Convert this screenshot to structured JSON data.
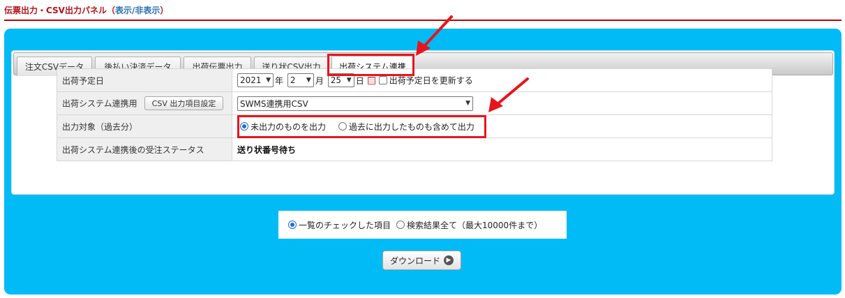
{
  "header": {
    "title": "伝票出力・CSV出力パネル（",
    "toggle_label": "表示/非表示",
    "title_close": "）"
  },
  "tabs": [
    {
      "label": "注文CSVデータ"
    },
    {
      "label": "後払い決済データ"
    },
    {
      "label": "出荷伝票出力"
    },
    {
      "label": "送り状CSV出力"
    },
    {
      "label": "出荷システム連携",
      "active": true
    }
  ],
  "form": {
    "ship_date": {
      "label": "出荷予定日",
      "year": "2021",
      "year_unit": "年",
      "month": "2",
      "month_unit": "月",
      "day": "25",
      "day_unit": "日",
      "update_label": "出荷予定日を更新する"
    },
    "integration": {
      "label": "出荷システム連携用",
      "csv_settings_button": "CSV 出力項目設定",
      "selected": "SWMS連携用CSV"
    },
    "target": {
      "label": "出力対象（過去分）",
      "option_unexported": "未出力のものを出力",
      "option_include_past": "過去に出力したものも含めて出力"
    },
    "status": {
      "label": "出荷システム連携後の受注ステータス",
      "value": "送り状番号待ち"
    }
  },
  "scope": {
    "option_checked": "一覧のチェックした項目",
    "option_all": "検索結果全て（最大10000件まで）"
  },
  "download_label": "ダウンロード",
  "colors": {
    "accent_blue": "#00bbf5",
    "highlight_red": "#e8141c",
    "header_red": "#b5121b"
  }
}
